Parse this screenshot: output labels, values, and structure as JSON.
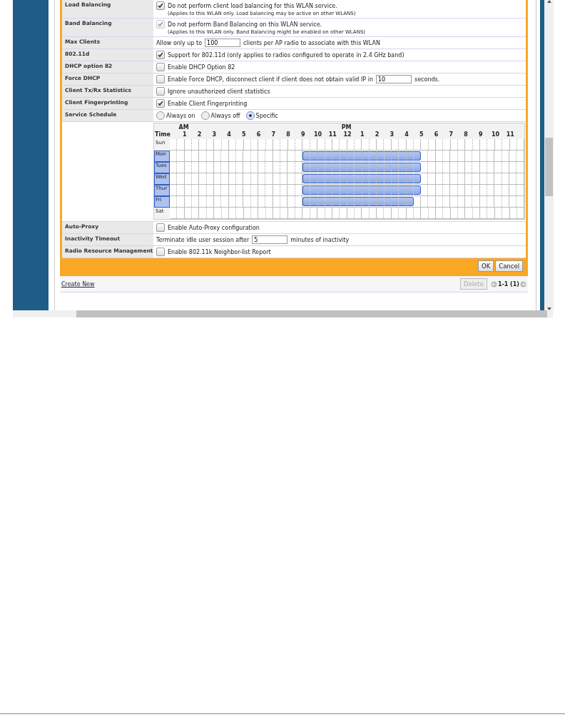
{
  "form": {
    "rows": [
      {
        "label": "Load Balancing",
        "kind": "checkbox",
        "checked": true,
        "disabled": false,
        "text": "Do not perform client load balancing for this WLAN service.",
        "note": "(Applies to this WLAN only. Load balancing may be active on other WLANS)"
      },
      {
        "label": "Band Balancing",
        "kind": "checkbox",
        "checked": true,
        "disabled": true,
        "text": "Do not perform Band Balancing on this WLAN service.",
        "note": "(Applies to this WLAN only. Band Balancing might be enabled on other WLANS)"
      },
      {
        "label": "Max Clients",
        "kind": "number",
        "prefix": "Allow only up to",
        "value": "100",
        "suffix": "clients per AP radio to associate with this WLAN"
      },
      {
        "label": "802.11d",
        "kind": "checkbox",
        "checked": true,
        "disabled": false,
        "text": "Support for 802.11d (only applies to radios configured to operate in 2.4 GHz band)"
      },
      {
        "label": "DHCP option 82",
        "kind": "checkbox",
        "checked": false,
        "disabled": false,
        "text": "Enable DHCP Option 82"
      },
      {
        "label": "Force DHCP",
        "kind": "checkbox",
        "checked": false,
        "disabled": false,
        "text": "Enable Force DHCP, disconnect client if client does not obtain valid IP in",
        "value": "10",
        "suffix": "seconds."
      },
      {
        "label": "Client Tx/Rx Statistics",
        "kind": "checkbox",
        "checked": false,
        "disabled": false,
        "text": "Ignore unauthorized client statistics"
      },
      {
        "label": "Client Fingerprinting",
        "kind": "checkbox",
        "checked": true,
        "disabled": false,
        "text": "Enable Client Fingerprinting"
      },
      {
        "label": "Service Schedule",
        "kind": "radio",
        "options": [
          {
            "label": "Always on",
            "selected": false
          },
          {
            "label": "Always off",
            "selected": false
          },
          {
            "label": "Specific",
            "selected": true
          }
        ]
      },
      {
        "kind": "schedule",
        "am": "AM",
        "pm": "PM",
        "time_label": "Time",
        "hours": [
          "1",
          "2",
          "3",
          "4",
          "5",
          "6",
          "7",
          "8",
          "9",
          "10",
          "11",
          "12",
          "1",
          "2",
          "3",
          "4",
          "5",
          "6",
          "7",
          "8",
          "9",
          "10",
          "11"
        ],
        "days": [
          {
            "name": "Sun",
            "selected": false
          },
          {
            "name": "Mon",
            "selected": true,
            "half_hours": [
              false,
              false,
              false,
              false,
              false,
              false,
              false,
              false,
              false,
              false,
              false,
              false,
              false,
              false,
              false,
              false,
              false,
              false,
              true,
              true,
              true,
              true,
              true,
              true,
              true,
              true,
              true,
              true,
              true,
              true,
              true,
              true,
              true,
              true,
              false,
              false,
              false,
              false,
              false,
              false,
              false,
              false,
              false,
              false,
              false,
              false,
              false,
              false
            ]
          },
          {
            "name": "Tues",
            "selected": true,
            "half_hours": [
              false,
              false,
              false,
              false,
              false,
              false,
              false,
              false,
              false,
              false,
              false,
              false,
              false,
              false,
              false,
              false,
              false,
              false,
              true,
              true,
              true,
              true,
              true,
              true,
              true,
              true,
              true,
              true,
              true,
              true,
              true,
              true,
              true,
              true,
              false,
              false,
              false,
              false,
              false,
              false,
              false,
              false,
              false,
              false,
              false,
              false,
              false,
              false
            ]
          },
          {
            "name": "Wed",
            "selected": true,
            "half_hours": [
              false,
              false,
              false,
              false,
              false,
              false,
              false,
              false,
              false,
              false,
              false,
              false,
              false,
              false,
              false,
              false,
              false,
              false,
              true,
              true,
              true,
              true,
              true,
              true,
              true,
              true,
              true,
              true,
              true,
              true,
              true,
              true,
              true,
              true,
              false,
              false,
              false,
              false,
              false,
              false,
              false,
              false,
              false,
              false,
              false,
              false,
              false,
              false
            ]
          },
          {
            "name": "Thur",
            "selected": true,
            "half_hours": [
              false,
              false,
              false,
              false,
              false,
              false,
              false,
              false,
              false,
              false,
              false,
              false,
              false,
              false,
              false,
              false,
              false,
              false,
              true,
              true,
              true,
              true,
              true,
              true,
              true,
              true,
              true,
              true,
              true,
              true,
              true,
              true,
              true,
              true,
              false,
              false,
              false,
              false,
              false,
              false,
              false,
              false,
              false,
              false,
              false,
              false,
              false,
              false
            ]
          },
          {
            "name": "Fri",
            "selected": true,
            "half_hours": [
              false,
              false,
              false,
              false,
              false,
              false,
              false,
              false,
              false,
              false,
              false,
              false,
              false,
              false,
              false,
              false,
              false,
              false,
              true,
              true,
              true,
              true,
              true,
              true,
              true,
              true,
              true,
              true,
              true,
              true,
              true,
              true,
              true,
              false,
              false,
              false,
              false,
              false,
              false,
              false,
              false,
              false,
              false,
              false,
              false,
              false,
              false,
              false
            ]
          },
          {
            "name": "Sat",
            "selected": false
          }
        ]
      },
      {
        "label": "Auto-Proxy",
        "kind": "checkbox",
        "checked": false,
        "disabled": false,
        "text": "Enable Auto-Proxy configuration"
      },
      {
        "label": "Inactivity Timeout",
        "kind": "number",
        "prefix": "Terminate idle user session after",
        "value": "5",
        "suffix": "minutes of inactivity"
      },
      {
        "label": "Radio Resource Management",
        "kind": "checkbox",
        "checked": false,
        "disabled": false,
        "text": "Enable 802.11k Neighbor-list Report"
      }
    ],
    "buttons": [
      "OK",
      "Cancel"
    ]
  },
  "footer": {
    "link": "Create New",
    "delete": {
      "label": "Delete",
      "disabled": true
    },
    "pagination": "1-1 (1)"
  }
}
